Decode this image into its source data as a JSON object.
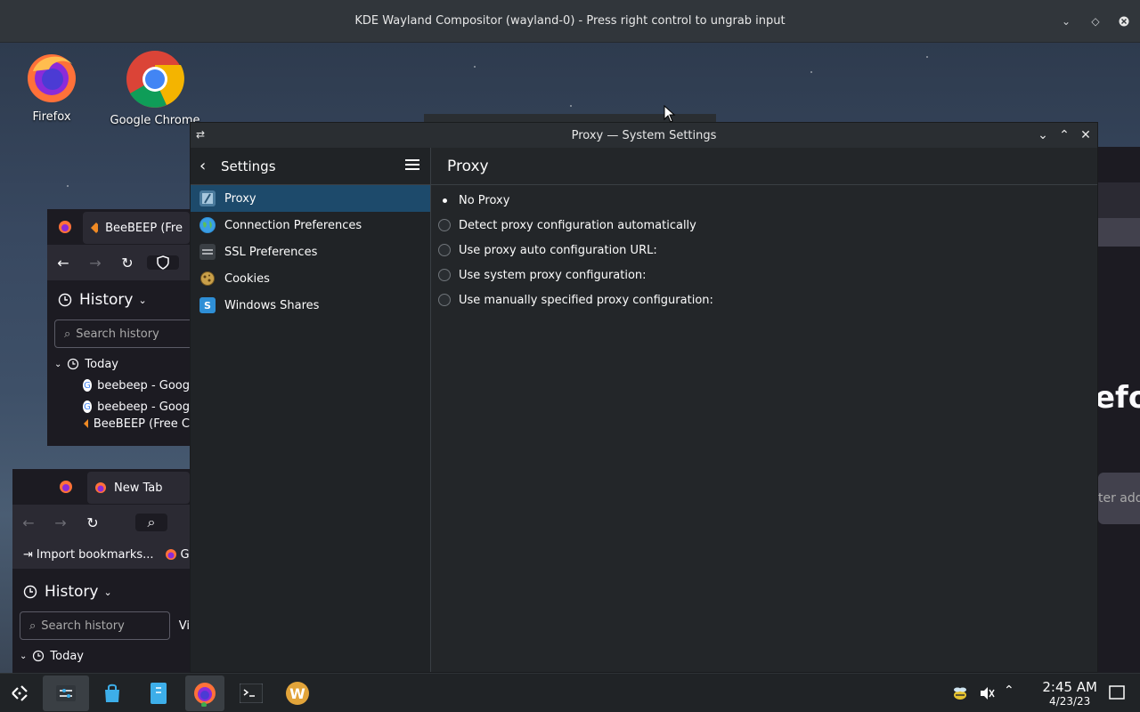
{
  "compositor": {
    "title": "KDE Wayland Compositor (wayland-0) - Press right control to ungrab input"
  },
  "desktop": {
    "icons": [
      {
        "label": "Firefox",
        "icon": "firefox-icon"
      },
      {
        "label": "Google Chrome",
        "icon": "chrome-icon"
      }
    ]
  },
  "ff_window_1": {
    "tab_label": "BeeBEEP (Fre",
    "sidebar_title": "History",
    "search_placeholder": "Search history",
    "group_label": "Today",
    "items": [
      "beebeep - Goog",
      "beebeep - Goog",
      "BeeBEEP (Free C"
    ]
  },
  "ff_window_2": {
    "tab_label": "New Tab",
    "import_label": "Import bookmarks...",
    "bookmark_fragment": "G",
    "sidebar_title": "History",
    "search_placeholder": "Search history",
    "view_fragment": "Vi",
    "group_label": "Today"
  },
  "ff_right": {
    "brand_fragment": "efox",
    "address_fragment": "ter add"
  },
  "settings": {
    "window_title": "Proxy — System Settings",
    "sidebar_title": "Settings",
    "sidebar_items": [
      {
        "label": "Proxy",
        "icon": "proxy-icon",
        "active": true
      },
      {
        "label": "Connection Preferences",
        "icon": "globe-icon",
        "active": false
      },
      {
        "label": "SSL Preferences",
        "icon": "ssl-icon",
        "active": false
      },
      {
        "label": "Cookies",
        "icon": "cookie-icon",
        "active": false
      },
      {
        "label": "Windows Shares",
        "icon": "windows-shares-icon",
        "active": false
      }
    ],
    "page_title": "Proxy",
    "options": [
      {
        "label": "No Proxy",
        "checked": true
      },
      {
        "label": "Detect proxy configuration automatically",
        "checked": false
      },
      {
        "label": "Use proxy auto configuration URL:",
        "checked": false
      },
      {
        "label": "Use system proxy configuration:",
        "checked": false
      },
      {
        "label": "Use manually specified proxy configuration:",
        "checked": false
      }
    ]
  },
  "taskbar": {
    "time": "2:45 AM",
    "date": "4/23/23"
  },
  "colors": {
    "accent": "#1d4a6b",
    "window_bg": "#232629",
    "panel_bg": "#202326"
  }
}
